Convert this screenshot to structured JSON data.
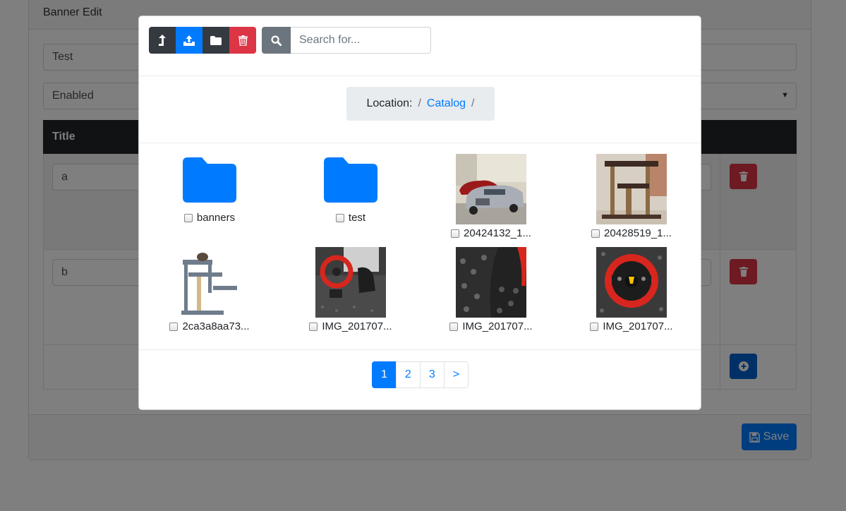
{
  "background": {
    "card_title": "Banner Edit",
    "name_value": "Test",
    "status_value": "Enabled",
    "table_header_title": "Title",
    "rows": [
      {
        "title": "a"
      },
      {
        "title": "b"
      }
    ],
    "save_label": "Save"
  },
  "toolbar": {
    "parent_icon": "level-up-icon",
    "upload_icon": "upload-icon",
    "new_folder_icon": "folder-icon",
    "delete_icon": "trash-icon",
    "search_icon": "search-icon",
    "search_placeholder": "Search for..."
  },
  "breadcrumb": {
    "label": "Location:",
    "items": [
      "Catalog"
    ]
  },
  "files": [
    {
      "name": "banners",
      "type": "folder"
    },
    {
      "name": "test",
      "type": "folder"
    },
    {
      "name": "20424132_1...",
      "type": "image",
      "subject": "cars-in-garage"
    },
    {
      "name": "20428519_1...",
      "type": "image",
      "subject": "wooden-cat-tree"
    },
    {
      "name": "2ca3a8aa73...",
      "type": "image",
      "subject": "grey-cat-tree"
    },
    {
      "name": "IMG_201707...",
      "type": "image",
      "subject": "racing-wheel-pedals"
    },
    {
      "name": "IMG_201707...",
      "type": "image",
      "subject": "floor-mat-closeup"
    },
    {
      "name": "IMG_201707...",
      "type": "image",
      "subject": "racing-wheel"
    }
  ],
  "pagination": {
    "pages": [
      "1",
      "2",
      "3",
      ">"
    ],
    "active": "1"
  },
  "colors": {
    "primary": "#007bff",
    "danger": "#dc3545",
    "dark": "#343a40",
    "secondary": "#6c757d"
  }
}
